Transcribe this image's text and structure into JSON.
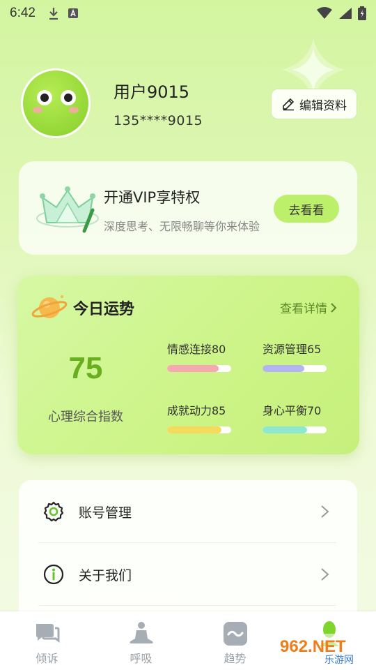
{
  "status_bar": {
    "time": "6:42"
  },
  "profile": {
    "username": "用户9015",
    "phone": "135****9015",
    "edit_label": "编辑资料"
  },
  "vip": {
    "title": "开通VIP享特权",
    "subtitle": "深度思考、无限畅聊等你来体验",
    "button_label": "去看看"
  },
  "fortune": {
    "title": "今日运势",
    "detail_link": "查看详情",
    "score": "75",
    "score_label": "心理综合指数",
    "metrics": [
      {
        "label": "情感连接80",
        "value": 80,
        "color": "#f5a8b0"
      },
      {
        "label": "资源管理65",
        "value": 65,
        "color": "#b3b4f5"
      },
      {
        "label": "成就动力85",
        "value": 85,
        "color": "#f5da5e"
      },
      {
        "label": "身心平衡70",
        "value": 70,
        "color": "#8ee8cf"
      }
    ]
  },
  "menu": {
    "items": [
      {
        "label": "账号管理",
        "icon": "gear-icon"
      },
      {
        "label": "关于我们",
        "icon": "info-icon"
      }
    ]
  },
  "tabs": [
    {
      "label": "倾诉",
      "icon": "chat-bubble-icon"
    },
    {
      "label": "呼吸",
      "icon": "meditation-icon"
    },
    {
      "label": "趋势",
      "icon": "trend-wave-icon"
    },
    {
      "label": "",
      "icon": "profile-icon"
    }
  ],
  "watermark": {
    "text": "962.NET",
    "subtext": "乐游网"
  },
  "colors": {
    "accent": "#bdf06a",
    "score": "#68ae1e",
    "detail_link": "#5d8a2a"
  }
}
